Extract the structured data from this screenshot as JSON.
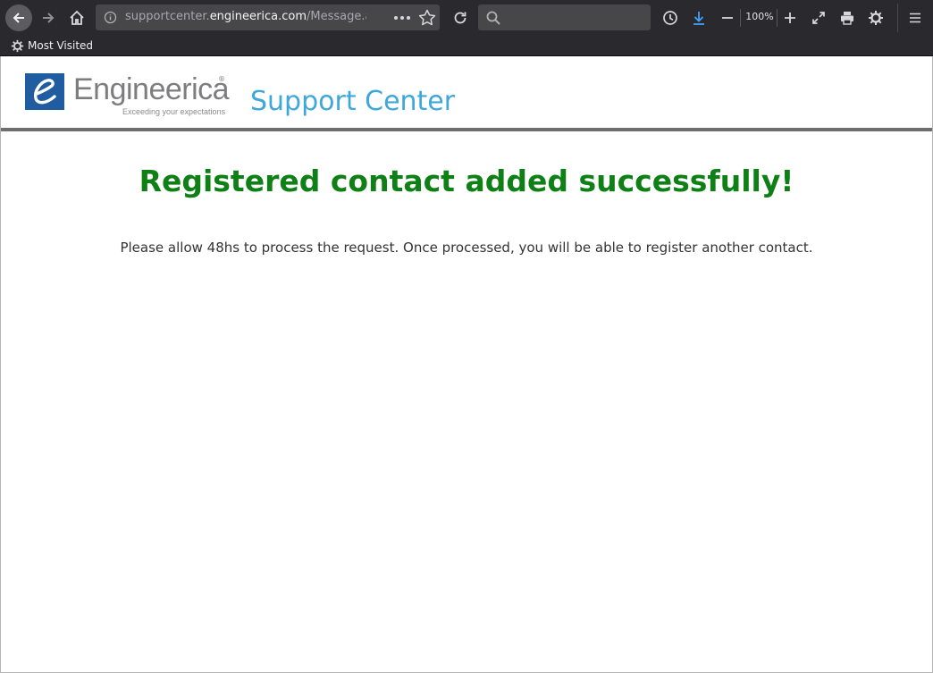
{
  "browser": {
    "url_prefix": "supportcenter.",
    "url_domain": "engineerica.com",
    "url_path": "/Message.as",
    "zoom_level": "100%",
    "bookmarks_label": "Most Visited"
  },
  "site": {
    "logo_text": "Engineerica",
    "logo_reg": "®",
    "logo_tagline": "Exceeding your expectations",
    "title": "Support Center"
  },
  "message": {
    "title": "Registered contact added successfully!",
    "body": "Please allow 48hs to process the request. Once processed, you will be able to register another contact."
  },
  "colors": {
    "title_green": "#0f8016",
    "site_title_blue": "#3ea7dc",
    "logo_blue": "#1f5da0",
    "download_blue": "#45a1ff"
  }
}
